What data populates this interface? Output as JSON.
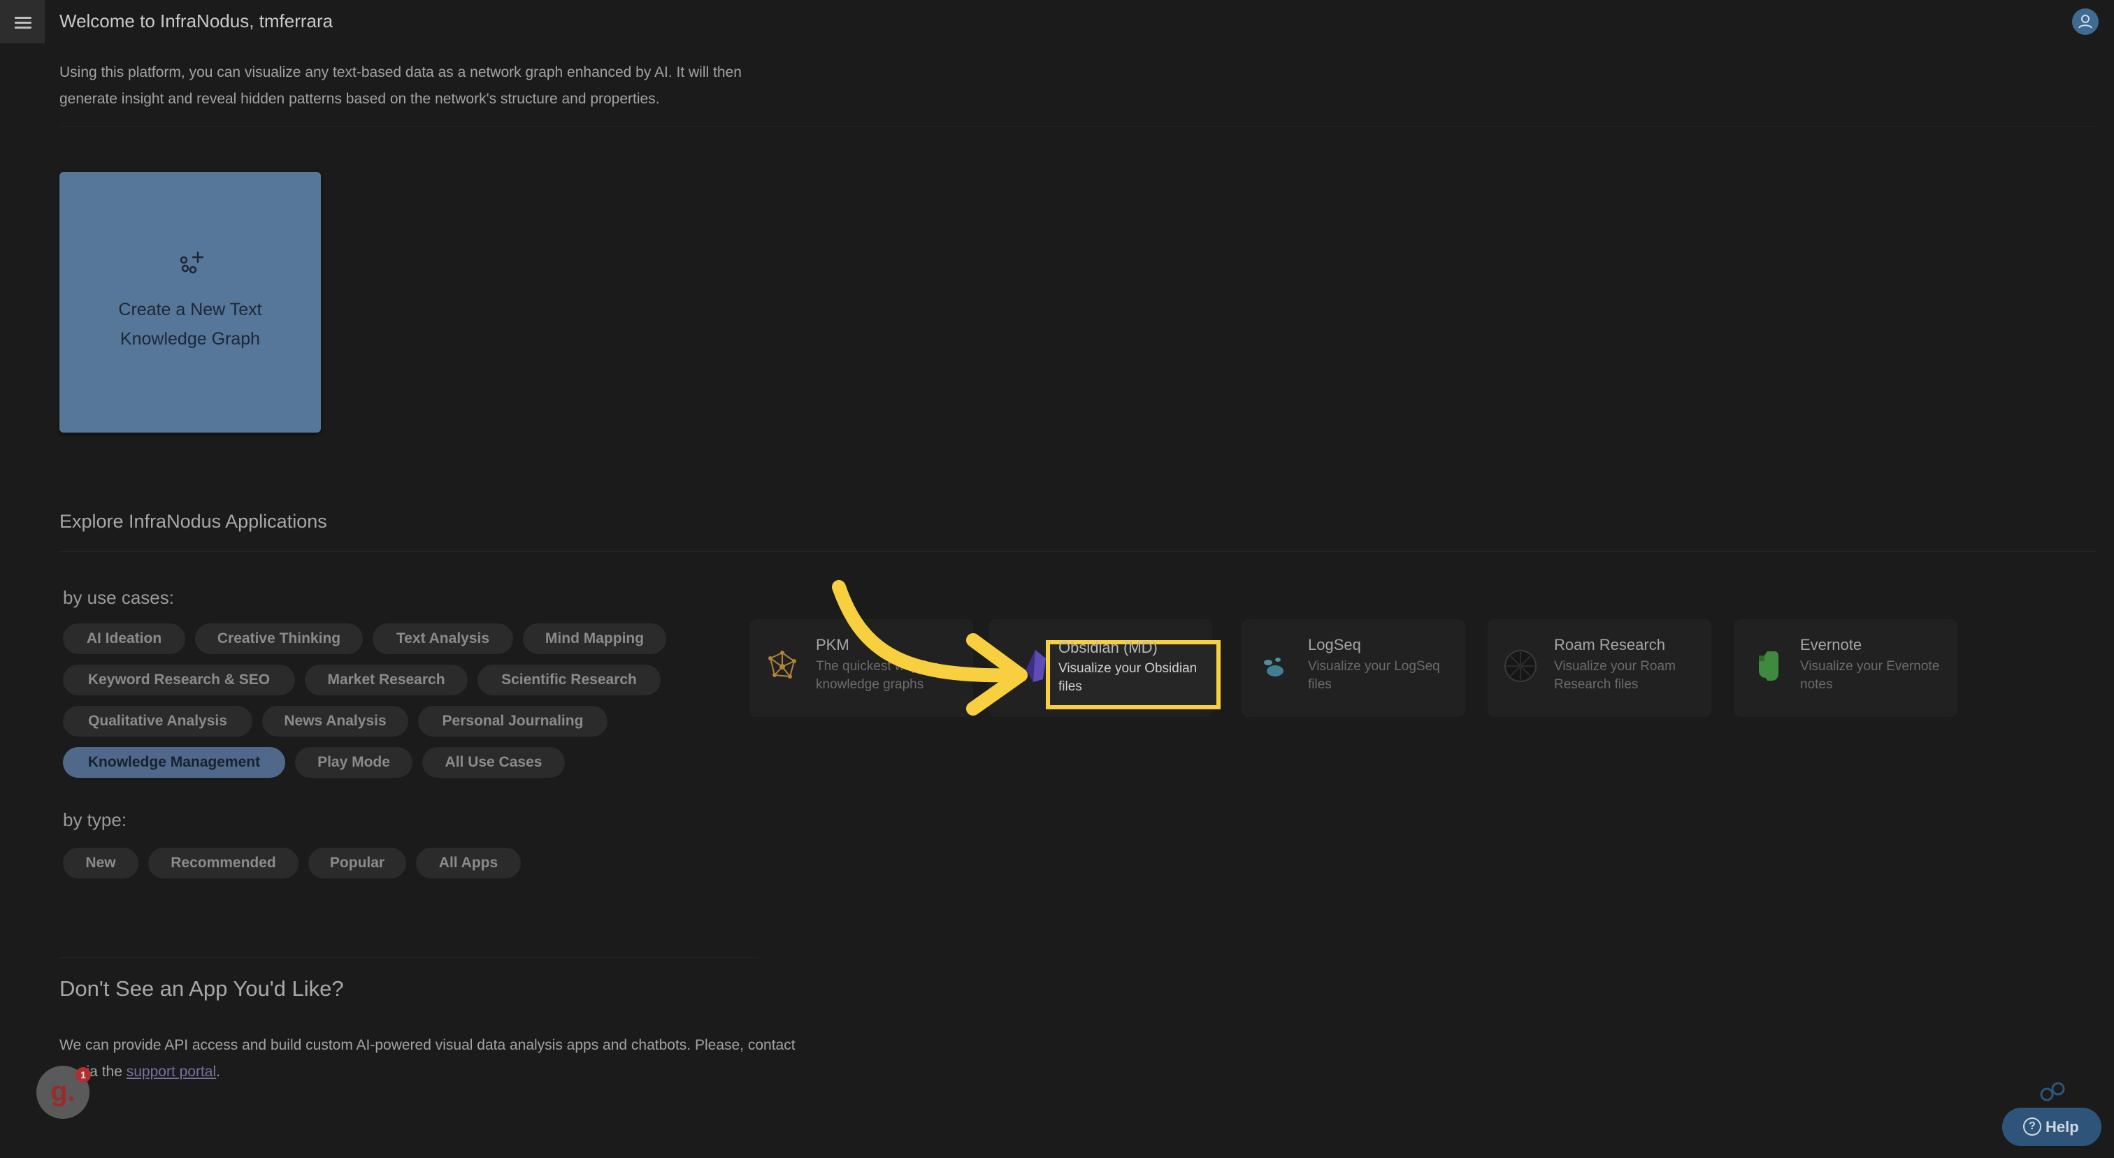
{
  "header": {
    "title": "Welcome to InfraNodus, tmferrara",
    "intro": "Using this platform, you can visualize any text-based data as a network graph enhanced by AI. It will then generate insight and reveal hidden patterns based on the network's structure and properties."
  },
  "create_card": {
    "label": "Create a New Text Knowledge Graph"
  },
  "explore": {
    "title": "Explore InfraNodus Applications",
    "by_use_cases_label": "by use cases:",
    "use_cases": [
      "AI Ideation",
      "Creative Thinking",
      "Text Analysis",
      "Mind Mapping",
      "Keyword Research & SEO",
      "Market Research",
      "Scientific Research",
      "Qualitative Analysis",
      "News Analysis",
      "Personal Journaling",
      "Knowledge Management",
      "Play Mode",
      "All Use Cases"
    ],
    "active_use_case": "Knowledge Management",
    "by_type_label": "by type:",
    "types": [
      "New",
      "Recommended",
      "Popular",
      "All Apps"
    ]
  },
  "apps": [
    {
      "name": "PKM",
      "desc": "The quickest way for knowledge graphs",
      "icon": "network-icon",
      "color": "#b0843a"
    },
    {
      "name": "Obsidian (MD)",
      "desc": "Visualize your Obsidian files",
      "icon": "obsidian-icon",
      "color": "#6a55c8"
    },
    {
      "name": "LogSeq",
      "desc": "Visualize your LogSeq files",
      "icon": "logseq-icon",
      "color": "#4b8fa0"
    },
    {
      "name": "Roam Research",
      "desc": "Visualize your Roam Research files",
      "icon": "roam-icon",
      "color": "#1a1a1a"
    },
    {
      "name": "Evernote",
      "desc": "Visualize your Evernote notes",
      "icon": "evernote-icon",
      "color": "#3f8a3f"
    }
  ],
  "custom": {
    "title": "Don't See an App You'd Like?",
    "text_before_link": "We can provide API access and build custom AI-powered visual data analysis apps and chatbots. Please, contact us via the ",
    "link": "support portal",
    "text_after_link": "."
  },
  "overlay": {
    "notification_badge": "1",
    "help_label": "Help",
    "highlight_color": "#f8cf3f"
  }
}
